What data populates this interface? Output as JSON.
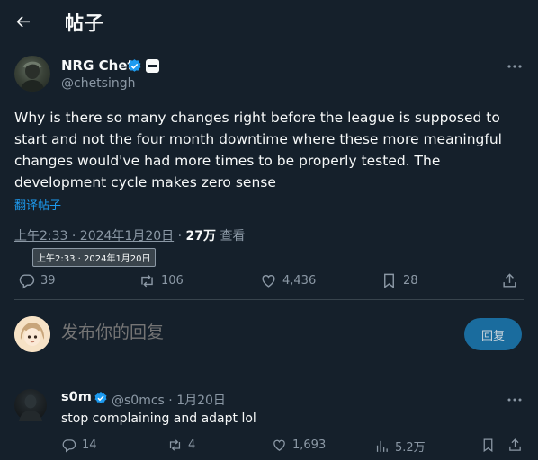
{
  "header": {
    "title": "帖子"
  },
  "tweet": {
    "author_name": "NRG Chet",
    "author_handle": "@chetsingh",
    "text": "Why is there so many changes right before the league is supposed to start and not the four month downtime where these more meaningful changes would've had more times to be properly tested. The development cycle makes zero sense",
    "translate_label": "翻译帖子",
    "timestamp": "上午2:33 · 2024年1月20日",
    "views_count": "27万",
    "views_label": "查看",
    "tooltip": "上午2:33 · 2024年1月20日",
    "stats": {
      "replies": "39",
      "reposts": "106",
      "likes": "4,436",
      "bookmarks": "28"
    }
  },
  "composer": {
    "placeholder": "发布你的回复",
    "button_label": "回复"
  },
  "reply": {
    "author_name": "s0m",
    "author_handle": "@s0mcs",
    "date": "1月20日",
    "text": "stop complaining and adapt lol",
    "stats": {
      "replies": "14",
      "reposts": "4",
      "likes": "1,693",
      "views": "5.2万"
    }
  },
  "colors": {
    "background": "#15202b",
    "accent": "#1d9bf0",
    "muted": "#8b98a5",
    "border": "#38444d"
  }
}
